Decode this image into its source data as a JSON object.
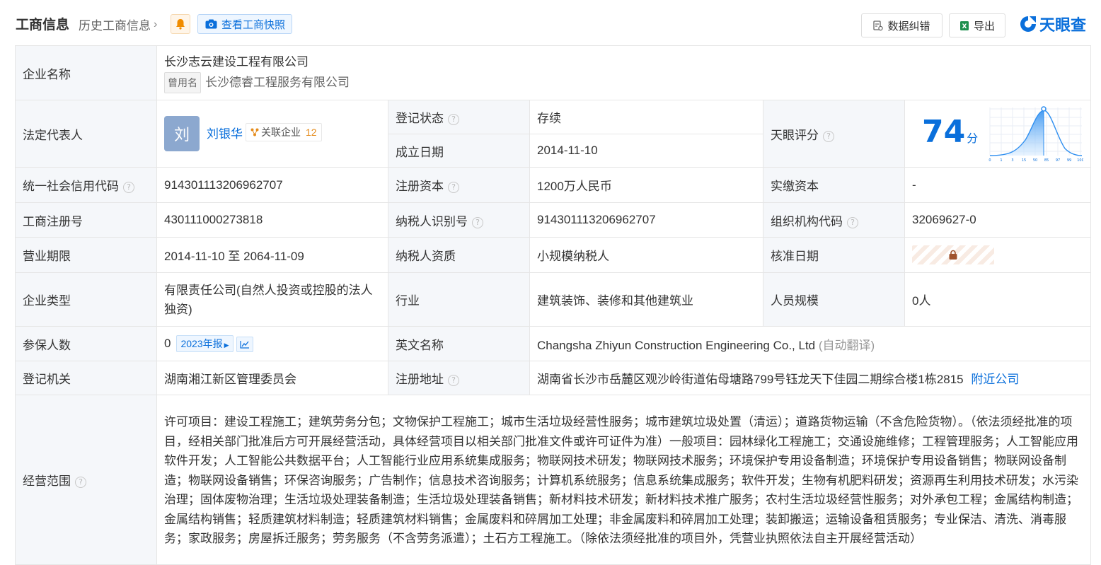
{
  "header": {
    "title": "工商信息",
    "history_link": "历史工商信息",
    "snapshot_btn": "查看工商快照",
    "correct_btn": "数据纠错",
    "export_btn": "导出",
    "logo_text": "天眼查",
    "brand_color": "#0a6fdb"
  },
  "company": {
    "name_label": "企业名称",
    "name": "长沙志云建设工程有限公司",
    "former_tag": "曾用名",
    "former_name": "长沙德睿工程服务有限公司"
  },
  "legal": {
    "label": "法定代表人",
    "avatar_char": "刘",
    "name": "刘银华",
    "related_label": "关联企业",
    "related_count": "12"
  },
  "reg_status": {
    "label": "登记状态",
    "value": "存续"
  },
  "founded": {
    "label": "成立日期",
    "value": "2014-11-10"
  },
  "rating": {
    "label": "天眼评分",
    "score": "74",
    "unit": "分",
    "axis_ticks": [
      "0",
      "1",
      "3",
      "15",
      "50",
      "85",
      "97",
      "99",
      "100"
    ]
  },
  "credit_code": {
    "label": "统一社会信用代码",
    "value": "91430111320696270​7"
  },
  "reg_capital": {
    "label": "注册资本",
    "value": "1200万人民币"
  },
  "paid_capital": {
    "label": "实缴资本",
    "value": "-"
  },
  "biz_reg_no": {
    "label": "工商注册号",
    "value": "430111000273818"
  },
  "taxpayer_id": {
    "label": "纳税人识别号",
    "value": "914301113206962707"
  },
  "org_code": {
    "label": "组织机构代码",
    "value": "32069627-0"
  },
  "biz_term": {
    "label": "营业期限",
    "value": "2014-11-10 至 2064-11-09"
  },
  "taxpayer_type": {
    "label": "纳税人资质",
    "value": "小规模纳税人"
  },
  "approval_date": {
    "label": "核准日期"
  },
  "company_type": {
    "label": "企业类型",
    "value": "有限责任公司(自然人投资或控股的法人独资)"
  },
  "industry": {
    "label": "行业",
    "value": "建筑装饰、装修和其他建筑业"
  },
  "staff_size": {
    "label": "人员规模",
    "value": "0人"
  },
  "insured": {
    "label": "参保人数",
    "value": "0",
    "report": "2023年报"
  },
  "english_name": {
    "label": "英文名称",
    "value": "Changsha Zhiyun Construction Engineering Co., Ltd",
    "note": "(自动翻译)"
  },
  "authority": {
    "label": "登记机关",
    "value": "湖南湘江新区管理委员会"
  },
  "address": {
    "label": "注册地址",
    "value": "湖南省长沙市岳麓区观沙岭街道佑母塘路799号钰龙天下佳园二期综合楼1栋2815",
    "nearby": "附近公司"
  },
  "scope": {
    "label": "经营范围",
    "value": "许可项目：建设工程施工；建筑劳务分包；文物保护工程施工；城市生活垃圾经营性服务；城市建筑垃圾处置（清运）；道路货物运输（不含危险货物）。（依法须经批准的项目，经相关部门批准后方可开展经营活动，具体经营项目以相关部门批准文件或许可证件为准）一般项目：园林绿化工程施工；交通设施维修；工程管理服务；人工智能应用软件开发；人工智能公共数据平台；人工智能行业应用系统集成服务；物联网技术研发；物联网技术服务；环境保护专用设备制造；环境保护专用设备销售；物联网设备制造；物联网设备销售；环保咨询服务；广告制作；信息技术咨询服务；计算机系统服务；信息系统集成服务；软件开发；生物有机肥料研发；资源再生利用技术研发；水污染治理；固体废物治理；生活垃圾处理装备制造；生活垃圾处理装备销售；新材料技术研发；新材料技术推广服务；农村生活垃圾经营性服务；对外承包工程；金属结构制造；金属结构销售；轻质建筑材料制造；轻质建筑材料销售；金属废料和碎屑加工处理；非金属废料和碎屑加工处理；装卸搬运；运输设备租赁服务；专业保洁、清洗、消毒服务；家政服务；房屋拆迁服务；劳务服务（不含劳务派遣）；土石方工程施工。（除依法须经批准的项目外，凭营业执照依法自主开展经营活动）"
  }
}
